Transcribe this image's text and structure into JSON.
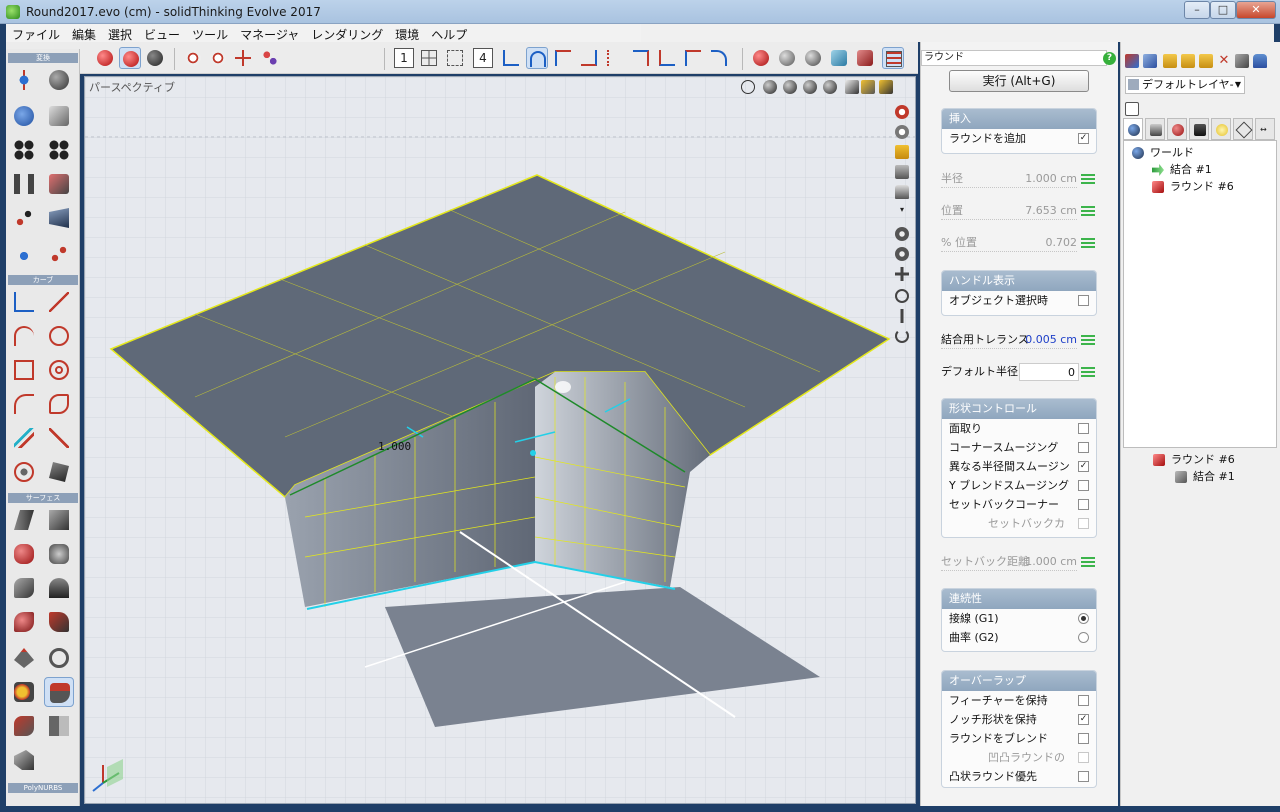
{
  "window": {
    "title": "Round2017.evo (cm) - solidThinking Evolve 2017",
    "minimize": "–",
    "maximize": "□",
    "close": "✕"
  },
  "menu": [
    "ファイル",
    "編集",
    "選択",
    "ビュー",
    "ツール",
    "マネージャ",
    "レンダリング",
    "環境",
    "ヘルプ"
  ],
  "toolbar": {
    "number_buttons": [
      "1",
      "4"
    ]
  },
  "palette": {
    "sections": [
      "変換",
      "カーブ",
      "サーフェス",
      "PolyNURBS"
    ]
  },
  "viewport": {
    "label": "パースペクティブ",
    "dimension_label": "1.000"
  },
  "panel": {
    "search_value": "ラウンド",
    "search_icon": "?",
    "execute_label": "実行 (Alt+G)",
    "insert_group": {
      "header": "挿入",
      "add_round_label": "ラウンドを追加",
      "add_round_checked": true
    },
    "radius": {
      "label": "半径",
      "value": "1.000 cm"
    },
    "position": {
      "label": "位置",
      "value": "7.653 cm"
    },
    "pct_position": {
      "label": "% 位置",
      "value": "0.702"
    },
    "handle_group": {
      "header": "ハンドル表示",
      "object_select_label": "オブジェクト選択時",
      "object_select_checked": false
    },
    "join_tolerance": {
      "label": "結合用トレランス",
      "value": "0.005 cm"
    },
    "default_radius": {
      "label": "デフォルト半径",
      "value": "0"
    },
    "shape_group": {
      "header": "形状コントロール",
      "items": [
        {
          "label": "面取り",
          "checked": false,
          "disabled": false
        },
        {
          "label": "コーナースムージング",
          "checked": false,
          "disabled": false
        },
        {
          "label": "異なる半径間スムージン",
          "checked": true,
          "disabled": false
        },
        {
          "label": "Y ブレンドスムージング",
          "checked": false,
          "disabled": false
        },
        {
          "label": "セットバックコーナー",
          "checked": false,
          "disabled": false
        },
        {
          "label": "セットバックカ",
          "checked": false,
          "disabled": true
        }
      ]
    },
    "setback_distance": {
      "label": "セットバック距離",
      "value": "1.000 cm"
    },
    "continuity_group": {
      "header": "連続性",
      "items": [
        {
          "label": "接線 (G1)",
          "selected": true
        },
        {
          "label": "曲率 (G2)",
          "selected": false
        }
      ]
    },
    "overlap_group": {
      "header": "オーバーラップ",
      "items": [
        {
          "label": "フィーチャーを保持",
          "checked": false,
          "disabled": false
        },
        {
          "label": "ノッチ形状を保持",
          "checked": true,
          "disabled": false
        },
        {
          "label": "ラウンドをブレンド",
          "checked": false,
          "disabled": false
        },
        {
          "label": "凹凸ラウンドの",
          "checked": false,
          "disabled": true
        },
        {
          "label": "凸状ラウンド優先",
          "checked": false,
          "disabled": false
        }
      ]
    }
  },
  "right_panel": {
    "layer": "デフォルトレイヤ-",
    "tree": {
      "world": "ワールド",
      "join": "結合 #1",
      "round": "ラウンド #6"
    },
    "history": {
      "round": "ラウンド #6",
      "join": "結合 #1"
    }
  },
  "colors": {
    "accent_green": "#3cb44b",
    "surface": "#5f6978",
    "edge_yellow": "#e4e81a",
    "edge_cyan": "#23d0e8",
    "group_header": "#8fa6be"
  }
}
